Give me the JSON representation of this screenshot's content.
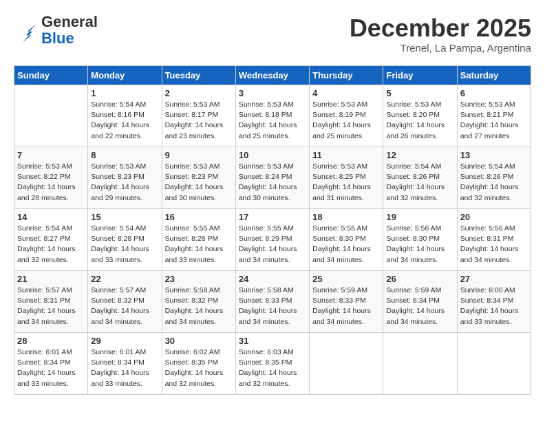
{
  "header": {
    "logo_general": "General",
    "logo_blue": "Blue",
    "month": "December 2025",
    "location": "Trenel, La Pampa, Argentina"
  },
  "days_of_week": [
    "Sunday",
    "Monday",
    "Tuesday",
    "Wednesday",
    "Thursday",
    "Friday",
    "Saturday"
  ],
  "weeks": [
    [
      {
        "day": "",
        "detail": ""
      },
      {
        "day": "1",
        "detail": "Sunrise: 5:54 AM\nSunset: 8:16 PM\nDaylight: 14 hours\nand 22 minutes."
      },
      {
        "day": "2",
        "detail": "Sunrise: 5:53 AM\nSunset: 8:17 PM\nDaylight: 14 hours\nand 23 minutes."
      },
      {
        "day": "3",
        "detail": "Sunrise: 5:53 AM\nSunset: 8:18 PM\nDaylight: 14 hours\nand 25 minutes."
      },
      {
        "day": "4",
        "detail": "Sunrise: 5:53 AM\nSunset: 8:19 PM\nDaylight: 14 hours\nand 25 minutes."
      },
      {
        "day": "5",
        "detail": "Sunrise: 5:53 AM\nSunset: 8:20 PM\nDaylight: 14 hours\nand 26 minutes."
      },
      {
        "day": "6",
        "detail": "Sunrise: 5:53 AM\nSunset: 8:21 PM\nDaylight: 14 hours\nand 27 minutes."
      }
    ],
    [
      {
        "day": "7",
        "detail": "Sunrise: 5:53 AM\nSunset: 8:22 PM\nDaylight: 14 hours\nand 28 minutes."
      },
      {
        "day": "8",
        "detail": "Sunrise: 5:53 AM\nSunset: 8:23 PM\nDaylight: 14 hours\nand 29 minutes."
      },
      {
        "day": "9",
        "detail": "Sunrise: 5:53 AM\nSunset: 8:23 PM\nDaylight: 14 hours\nand 30 minutes."
      },
      {
        "day": "10",
        "detail": "Sunrise: 5:53 AM\nSunset: 8:24 PM\nDaylight: 14 hours\nand 30 minutes."
      },
      {
        "day": "11",
        "detail": "Sunrise: 5:53 AM\nSunset: 8:25 PM\nDaylight: 14 hours\nand 31 minutes."
      },
      {
        "day": "12",
        "detail": "Sunrise: 5:54 AM\nSunset: 8:26 PM\nDaylight: 14 hours\nand 32 minutes."
      },
      {
        "day": "13",
        "detail": "Sunrise: 5:54 AM\nSunset: 8:26 PM\nDaylight: 14 hours\nand 32 minutes."
      }
    ],
    [
      {
        "day": "14",
        "detail": "Sunrise: 5:54 AM\nSunset: 8:27 PM\nDaylight: 14 hours\nand 32 minutes."
      },
      {
        "day": "15",
        "detail": "Sunrise: 5:54 AM\nSunset: 8:28 PM\nDaylight: 14 hours\nand 33 minutes."
      },
      {
        "day": "16",
        "detail": "Sunrise: 5:55 AM\nSunset: 8:28 PM\nDaylight: 14 hours\nand 33 minutes."
      },
      {
        "day": "17",
        "detail": "Sunrise: 5:55 AM\nSunset: 8:29 PM\nDaylight: 14 hours\nand 34 minutes."
      },
      {
        "day": "18",
        "detail": "Sunrise: 5:55 AM\nSunset: 8:30 PM\nDaylight: 14 hours\nand 34 minutes."
      },
      {
        "day": "19",
        "detail": "Sunrise: 5:56 AM\nSunset: 8:30 PM\nDaylight: 14 hours\nand 34 minutes."
      },
      {
        "day": "20",
        "detail": "Sunrise: 5:56 AM\nSunset: 8:31 PM\nDaylight: 14 hours\nand 34 minutes."
      }
    ],
    [
      {
        "day": "21",
        "detail": "Sunrise: 5:57 AM\nSunset: 8:31 PM\nDaylight: 14 hours\nand 34 minutes."
      },
      {
        "day": "22",
        "detail": "Sunrise: 5:57 AM\nSunset: 8:32 PM\nDaylight: 14 hours\nand 34 minutes."
      },
      {
        "day": "23",
        "detail": "Sunrise: 5:58 AM\nSunset: 8:32 PM\nDaylight: 14 hours\nand 34 minutes."
      },
      {
        "day": "24",
        "detail": "Sunrise: 5:58 AM\nSunset: 8:33 PM\nDaylight: 14 hours\nand 34 minutes."
      },
      {
        "day": "25",
        "detail": "Sunrise: 5:59 AM\nSunset: 8:33 PM\nDaylight: 14 hours\nand 34 minutes."
      },
      {
        "day": "26",
        "detail": "Sunrise: 5:59 AM\nSunset: 8:34 PM\nDaylight: 14 hours\nand 34 minutes."
      },
      {
        "day": "27",
        "detail": "Sunrise: 6:00 AM\nSunset: 8:34 PM\nDaylight: 14 hours\nand 33 minutes."
      }
    ],
    [
      {
        "day": "28",
        "detail": "Sunrise: 6:01 AM\nSunset: 8:34 PM\nDaylight: 14 hours\nand 33 minutes."
      },
      {
        "day": "29",
        "detail": "Sunrise: 6:01 AM\nSunset: 8:34 PM\nDaylight: 14 hours\nand 33 minutes."
      },
      {
        "day": "30",
        "detail": "Sunrise: 6:02 AM\nSunset: 8:35 PM\nDaylight: 14 hours\nand 32 minutes."
      },
      {
        "day": "31",
        "detail": "Sunrise: 6:03 AM\nSunset: 8:35 PM\nDaylight: 14 hours\nand 32 minutes."
      },
      {
        "day": "",
        "detail": ""
      },
      {
        "day": "",
        "detail": ""
      },
      {
        "day": "",
        "detail": ""
      }
    ]
  ]
}
